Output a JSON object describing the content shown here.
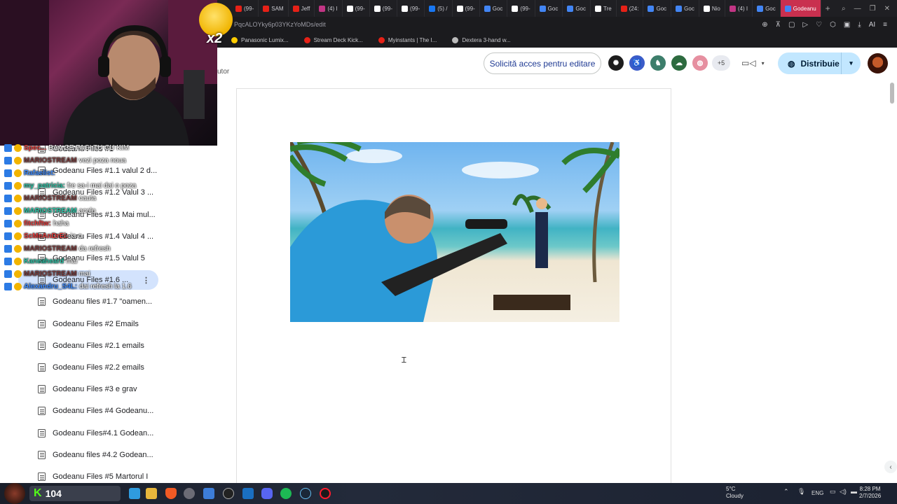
{
  "browser": {
    "tabs": [
      {
        "label": "(99-",
        "color": "#e62117"
      },
      {
        "label": "SAM",
        "color": "#e62117"
      },
      {
        "label": "Jeff",
        "color": "#e62117"
      },
      {
        "label": "(4) I",
        "color": "#c13584"
      },
      {
        "label": "(99-",
        "color": "#ffffff"
      },
      {
        "label": "(99-",
        "color": "#ffffff"
      },
      {
        "label": "(99-",
        "color": "#ffffff"
      },
      {
        "label": "(5) /",
        "color": "#1877f2"
      },
      {
        "label": "(99-",
        "color": "#ffffff"
      },
      {
        "label": "Goc",
        "color": "#4285f4"
      },
      {
        "label": "(99-",
        "color": "#ffffff"
      },
      {
        "label": "Goc",
        "color": "#4285f4"
      },
      {
        "label": "Goc",
        "color": "#4285f4"
      },
      {
        "label": "Tre",
        "color": "#ffffff"
      },
      {
        "label": "(24:",
        "color": "#e62117"
      },
      {
        "label": "Goc",
        "color": "#4285f4"
      },
      {
        "label": "Goc",
        "color": "#4285f4"
      },
      {
        "label": "Nio",
        "color": "#ffffff"
      },
      {
        "label": "(4) I",
        "color": "#c13584"
      },
      {
        "label": "Goc",
        "color": "#4285f4"
      }
    ],
    "active_tab": "Godeanu",
    "url": "PqcALOYky6p03YKzYoMDs/edit",
    "bookmarks": [
      {
        "label": "Panasonic Lumix...",
        "color": "#ffcc00"
      },
      {
        "label": "Stream Deck Kick...",
        "color": "#e62117"
      },
      {
        "label": "Myinstants | The I...",
        "color": "#e62117"
      },
      {
        "label": "Dextera 3-hand w...",
        "color": "#bbbbbb"
      }
    ]
  },
  "header": {
    "partial_menu": "utor",
    "request_access": "Solicită acces pentru editare",
    "more_collaborators": "+5",
    "share": "Distribuie"
  },
  "outline": {
    "items": [
      "Godeanu Files #1",
      "Godeanu Files #1.1 valul 2 d...",
      "Godeanu Files #1.2 Valul 3 ...",
      "Godeanu Files #1.3 Mai mul...",
      "Godeanu Files #1.4 Valul 4 ...",
      "Godeanu Files #1.5 Valul 5",
      "Godeanu Files #1.6 ...",
      "Godeanu files #1.7 \"oamen...",
      "Godeanu Files #2 Emails",
      "Godeanu Files #2.1 emails",
      "Godeanu Files #2.2 emails",
      "Godeanu Files #3 e grav",
      "Godeanu Files #4 Godeanu...",
      "Godeanu Files#4.1 Godean...",
      "Godeanu files #4.2 Godean...",
      "Godeanu Files #5 Martorul I"
    ],
    "selected_index": 6
  },
  "chat": [
    {
      "user": "Spec...",
      "msg": "BAA CE FACI TU CU KIM",
      "user_color": "#e03a3a"
    },
    {
      "user": "MARIOSTREAM",
      "msg": "vezi poza noua",
      "user_color": "#7a3d3d"
    },
    {
      "user": "Rafaelist:",
      "msg": "",
      "user_color": "#3d8bff"
    },
    {
      "user": "my_patricia:",
      "msg": "fre sa-i mai dai o poza",
      "user_color": "#2fc4a7"
    },
    {
      "user": "MARIOSTREAM",
      "msg": "cauta",
      "user_color": "#7a3d3d"
    },
    {
      "user": "MARIOSTREAM",
      "msg": "acolo",
      "user_color": "#2fc4a7"
    },
    {
      "user": "fitchftw:",
      "msg": "haha",
      "user_color": "#e03a3a"
    },
    {
      "user": "ScMeAnDrEi:",
      "msg": "ia-o",
      "user_color": "#e03a3a"
    },
    {
      "user": "MARIOSTREAM",
      "msg": "da refresh",
      "user_color": "#7a3d3d"
    },
    {
      "user": "Kaneaheard",
      "msg": "mai",
      "user_color": "#2fc4a7"
    },
    {
      "user": "MARIOSTREAM",
      "msg": "mai",
      "user_color": "#7a3d3d"
    },
    {
      "user": "Alexandru_S4L:",
      "msg": "dai refresh la 1.6",
      "user_color": "#3d8bff"
    }
  ],
  "overlay": {
    "emote_multiplier": "x2",
    "viewer_count": "104",
    "kick_logo": "K"
  },
  "taskbar": {
    "temp": "5°C",
    "condition": "Cloudy",
    "language": "ENG",
    "time": "8:28 PM",
    "date": "2/7/2026"
  }
}
